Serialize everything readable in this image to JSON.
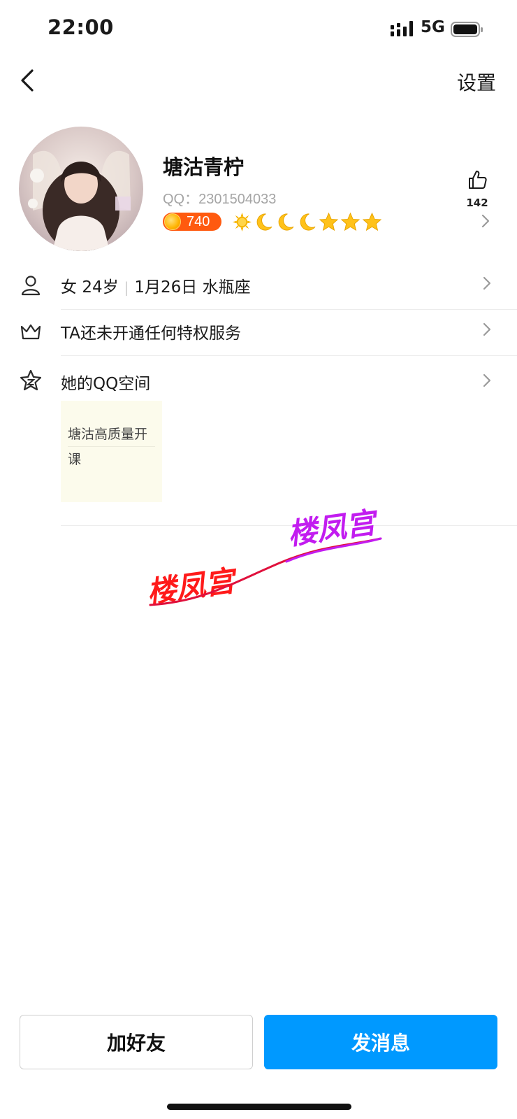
{
  "status_bar": {
    "time": "22:00",
    "network": "5G"
  },
  "nav": {
    "settings_label": "设置"
  },
  "profile": {
    "nickname": "塘沽青柠",
    "qq_label": "QQ：",
    "qq_number": "2301504033",
    "points": "740",
    "like_count": "142",
    "level_icons": [
      "sun-icon",
      "moon-icon",
      "moon-icon",
      "moon-icon",
      "star-icon",
      "star-icon",
      "star-icon"
    ]
  },
  "info_rows": {
    "basic": {
      "gender": "女",
      "age": "24岁",
      "birthday": "1月26日",
      "zodiac": "水瓶座",
      "separator": "|"
    },
    "privilege": {
      "text": "TA还未开通任何特权服务"
    },
    "qzone": {
      "text": "她的QQ空间",
      "card_line1": "塘沽高质量开",
      "card_line2": "课"
    }
  },
  "watermark": {
    "text1": "楼凤宫",
    "text2": "楼凤宫",
    "color1": "#ff1a1a",
    "color2": "#c21cf0"
  },
  "actions": {
    "add_friend": "加好友",
    "send_message": "发消息"
  },
  "colors": {
    "primary_button": "#0099ff",
    "points_badge": "#ff5a0f"
  }
}
